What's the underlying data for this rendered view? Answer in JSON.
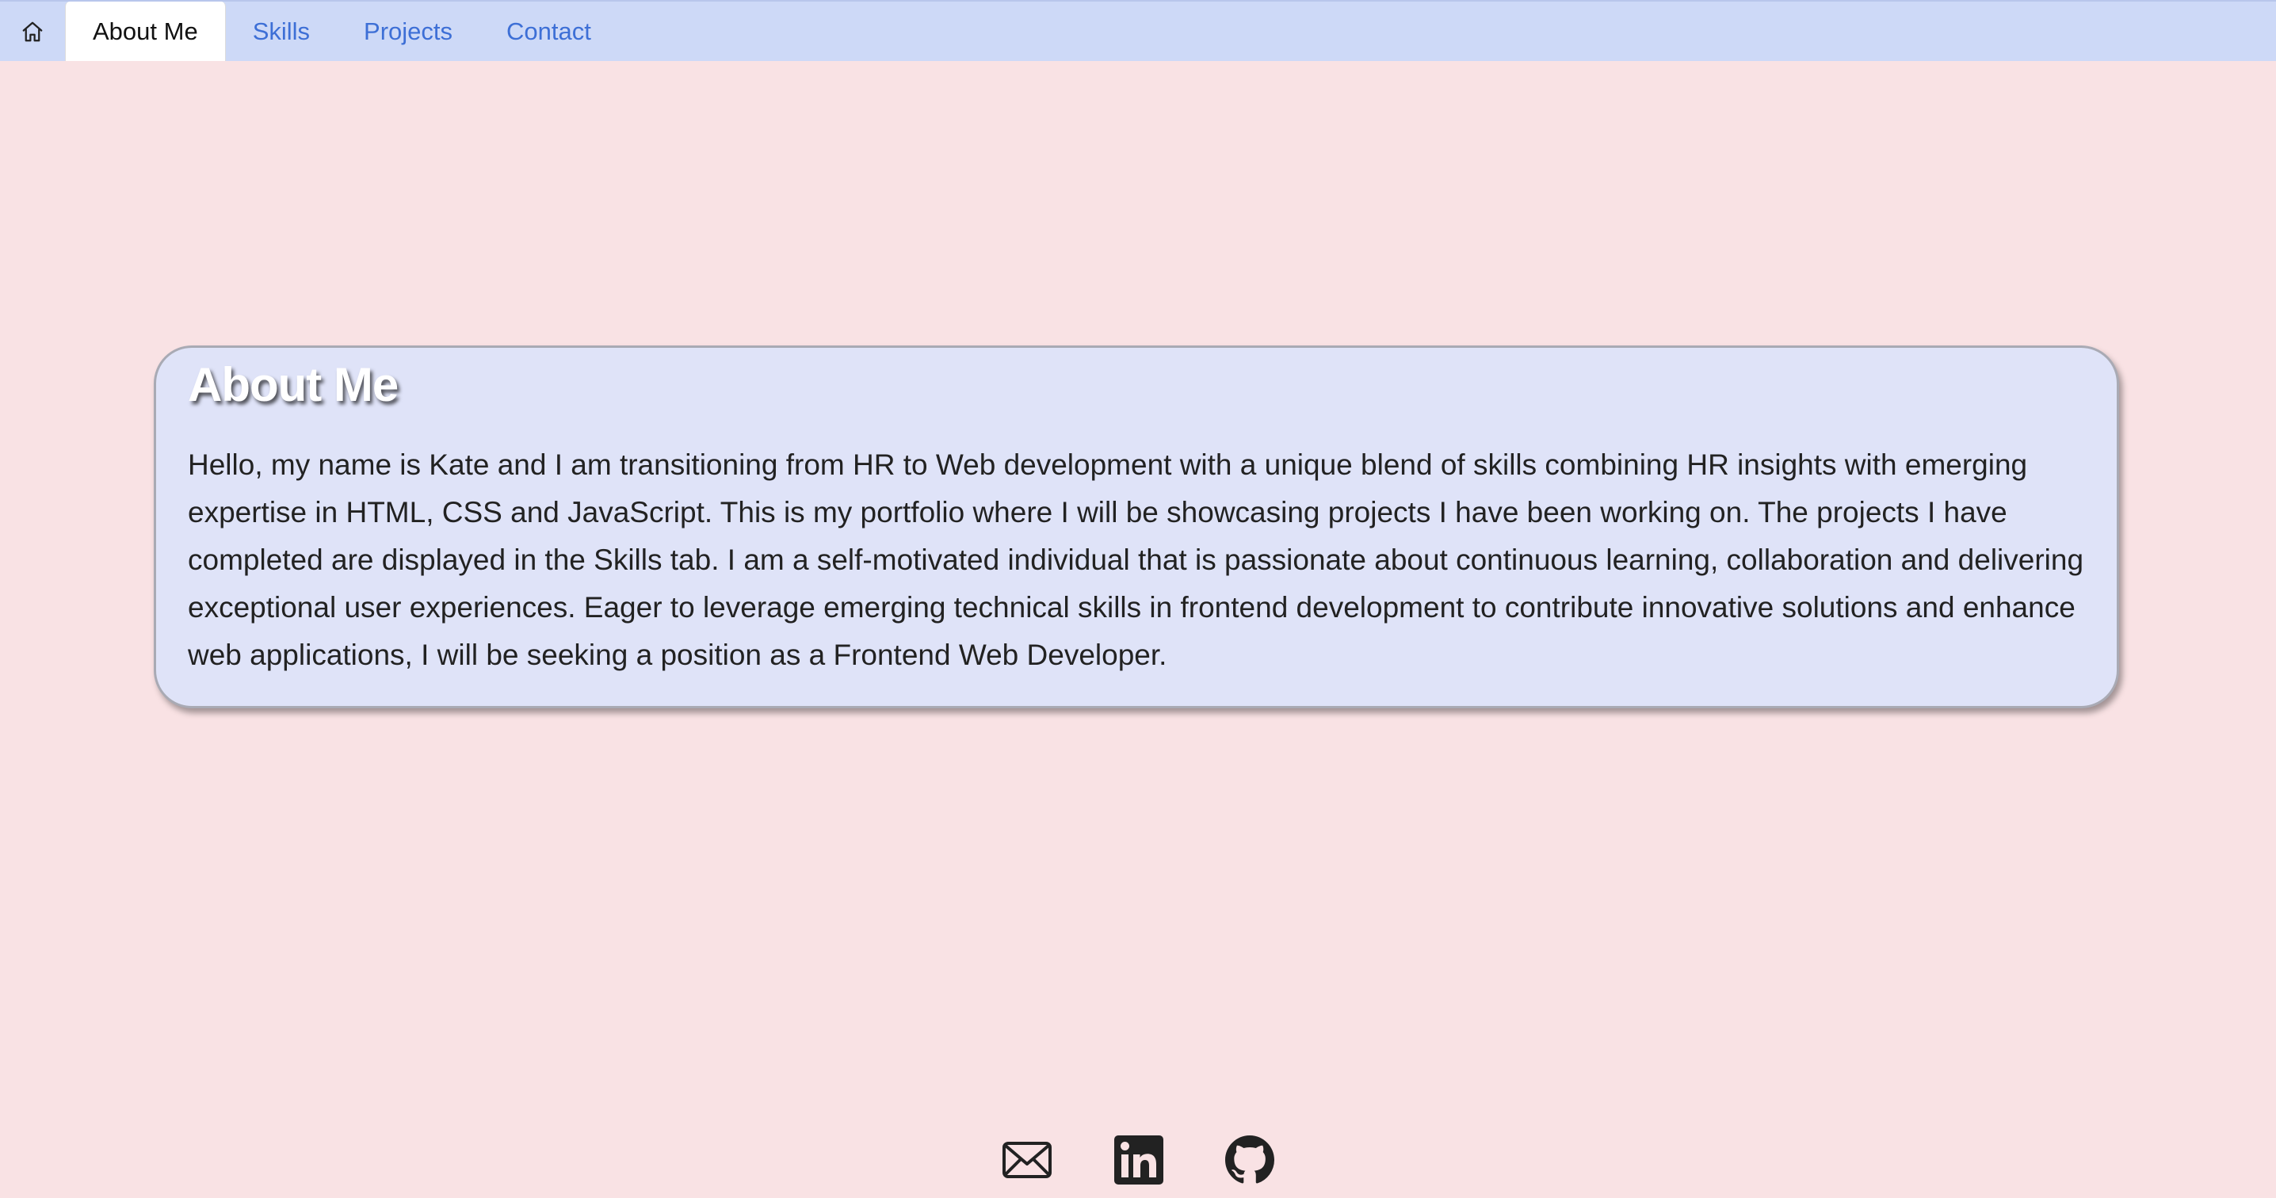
{
  "nav": {
    "home_icon": "house-icon",
    "tabs": [
      {
        "label": "About Me",
        "active": true
      },
      {
        "label": "Skills",
        "active": false
      },
      {
        "label": "Projects",
        "active": false
      },
      {
        "label": "Contact",
        "active": false
      }
    ]
  },
  "about": {
    "title": "About Me",
    "body": "Hello, my name is Kate and I am transitioning from HR to Web development with a unique blend of skills combining HR insights with emerging expertise in HTML, CSS and JavaScript. This is my portfolio where I will be showcasing projects I have been working on. The projects I have completed are displayed in the Skills tab. I am a self-motivated individual that is passionate about continuous learning, collaboration and delivering exceptional user experiences. Eager to leverage emerging technical skills in frontend development to contribute innovative solutions and enhance web applications, I will be seeking a position as a Frontend Web Developer."
  },
  "footer": {
    "icons": [
      "envelope-icon",
      "linkedin-icon",
      "github-icon"
    ]
  },
  "colors": {
    "page_background": "#f9e2e4",
    "navbar_background": "#cdd9f7",
    "link": "#3d6fd6",
    "card_background": "#dfe3f8"
  }
}
